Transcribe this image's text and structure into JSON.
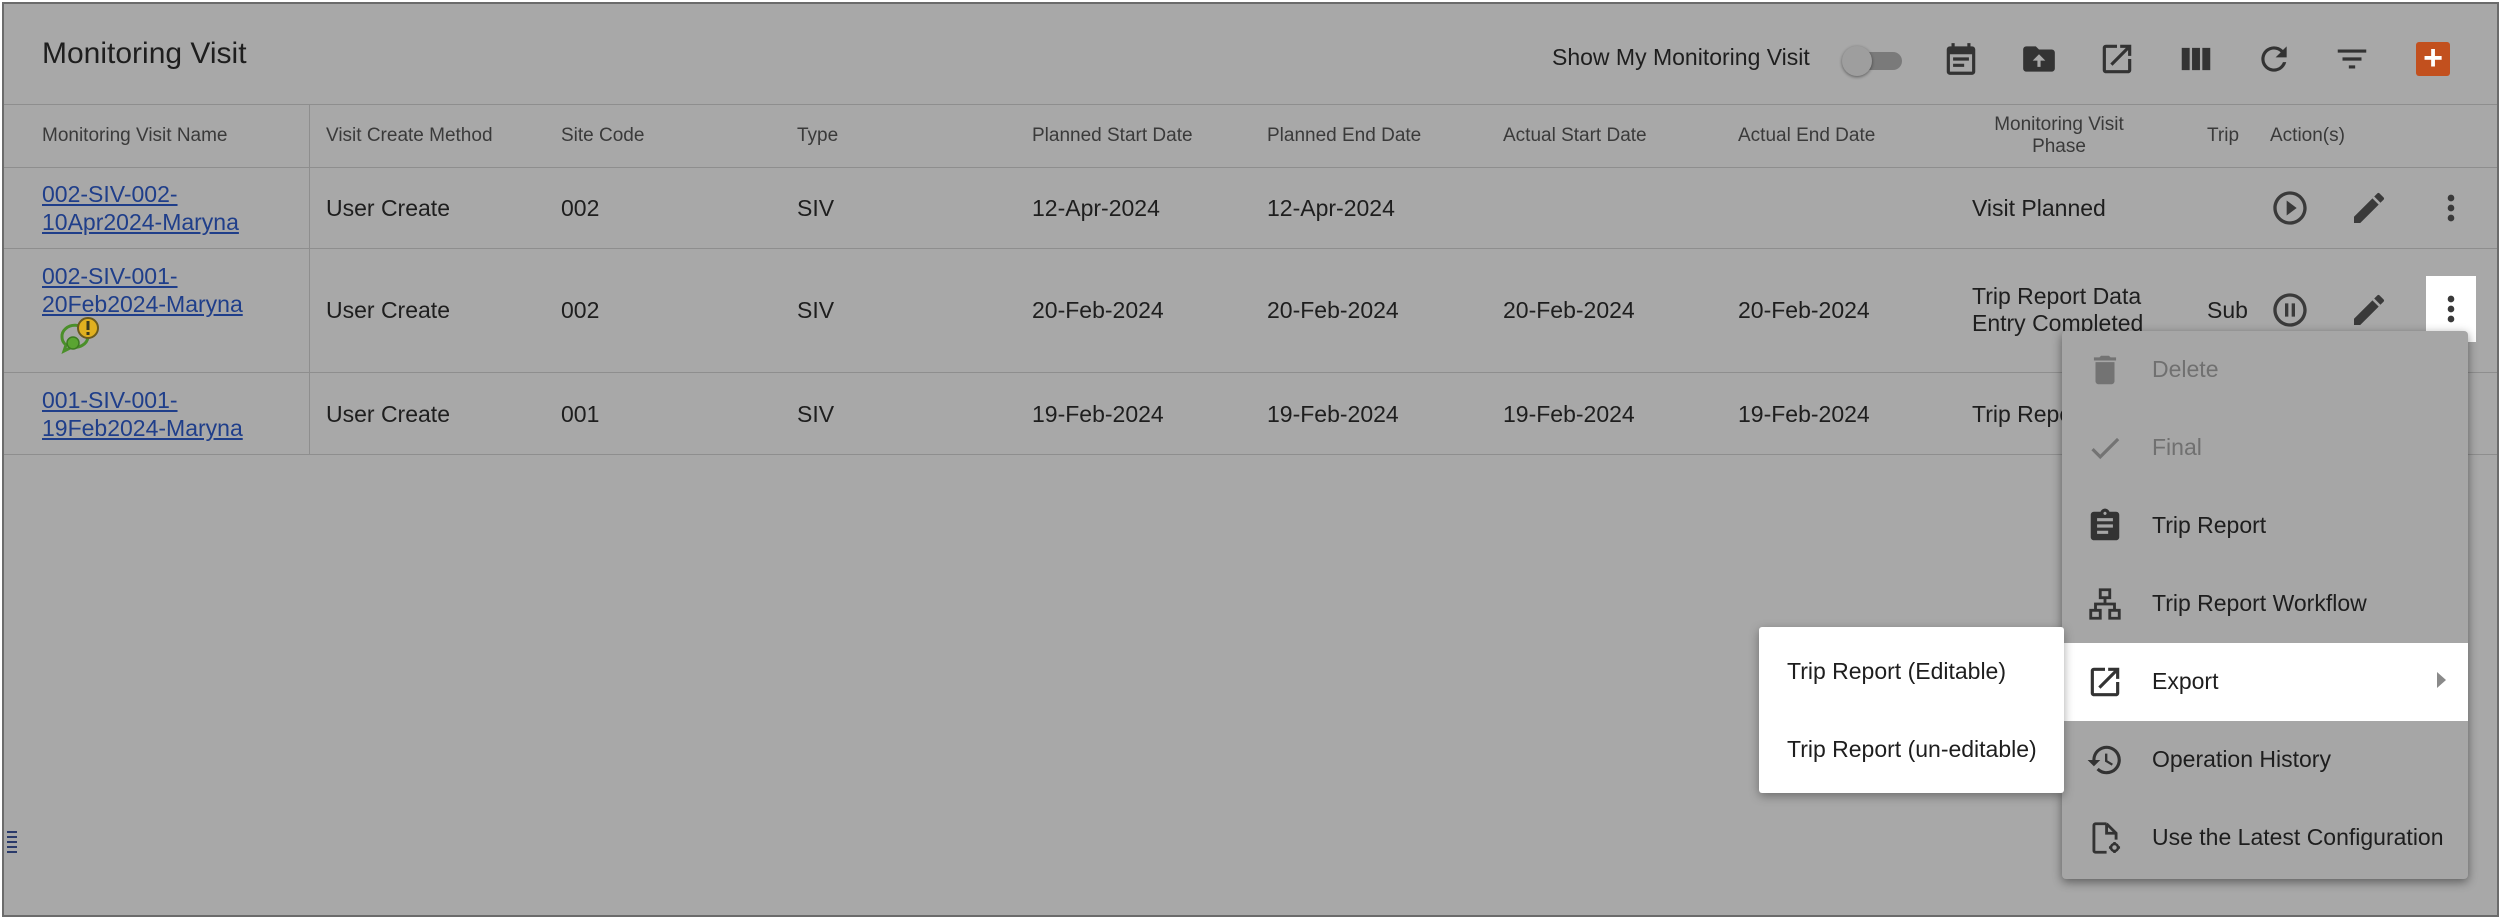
{
  "header": {
    "title": "Monitoring Visit",
    "show_my_label": "Show My Monitoring Visit",
    "toggle_on": false,
    "toolbar_icons": [
      "calendar-icon",
      "folder-upload-icon",
      "open-external-icon",
      "columns-icon",
      "refresh-icon",
      "filter-icon",
      "add-icon"
    ],
    "add_color": "#c2501e",
    "add_label": "+"
  },
  "table": {
    "columns": {
      "name": "Monitoring Visit Name",
      "method": "Visit Create Method",
      "site": "Site Code",
      "type": "Type",
      "pstart": "Planned Start Date",
      "pend": "Planned End Date",
      "astart": "Actual Start Date",
      "aend": "Actual End Date",
      "phase_line1": "Monitoring Visit",
      "phase_line2": "Phase",
      "trip": "Trip",
      "actions": "Action(s)"
    },
    "rows": [
      {
        "name_line1": "002-SIV-002-",
        "name_line2": "10Apr2024-Maryna",
        "method": "User Create",
        "site": "002",
        "type": "SIV",
        "pstart": "12-Apr-2024",
        "pend": "12-Apr-2024",
        "astart": "",
        "aend": "",
        "phase_line1": "Visit Planned",
        "phase_line2": "",
        "trip": ""
      },
      {
        "name_line1": "002-SIV-001-",
        "name_line2": "20Feb2024-Maryna",
        "method": "User Create",
        "site": "002",
        "type": "SIV",
        "pstart": "20-Feb-2024",
        "pend": "20-Feb-2024",
        "astart": "20-Feb-2024",
        "aend": "20-Feb-2024",
        "phase_line1": "Trip Report Data",
        "phase_line2": "Entry Completed",
        "trip": "Sub"
      },
      {
        "name_line1": "001-SIV-001-",
        "name_line2": "19Feb2024-Maryna",
        "method": "User Create",
        "site": "001",
        "type": "SIV",
        "pstart": "19-Feb-2024",
        "pend": "19-Feb-2024",
        "astart": "19-Feb-2024",
        "aend": "19-Feb-2024",
        "phase_line1": "Trip Repo",
        "phase_line2": "",
        "trip": ""
      }
    ]
  },
  "menu": {
    "items": [
      {
        "label": "Delete",
        "icon": "trash-icon",
        "disabled": true
      },
      {
        "label": "Final",
        "icon": "check-icon",
        "disabled": true
      },
      {
        "label": "Trip Report",
        "icon": "clipboard-icon",
        "disabled": false
      },
      {
        "label": "Trip Report Workflow",
        "icon": "workflow-icon",
        "disabled": false
      },
      {
        "label": "Export",
        "icon": "export-icon",
        "disabled": false,
        "has_submenu": true
      },
      {
        "label": "Operation History",
        "icon": "history-icon",
        "disabled": false
      },
      {
        "label": "Use the Latest Configuration",
        "icon": "file-settings-icon",
        "disabled": false
      }
    ],
    "submenu": [
      {
        "label": "Trip Report (Editable)"
      },
      {
        "label": "Trip Report (un-editable)"
      }
    ]
  },
  "colors": {
    "overlay_bg": "#a8a8a8",
    "link": "#1f3e8a",
    "alert_green": "#4a8f2a",
    "alert_yellow": "#e0b020"
  }
}
